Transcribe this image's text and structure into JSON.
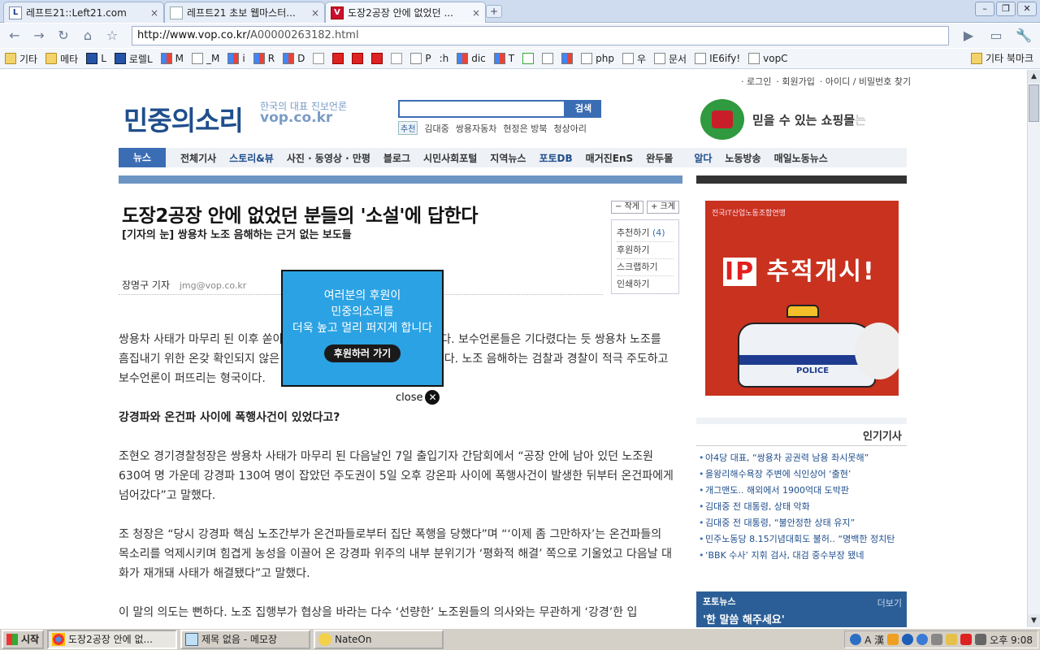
{
  "browser": {
    "tabs": [
      {
        "title": "레프트21::Left21.com",
        "favicon": "left21-icon"
      },
      {
        "title": "레프트21 초보 웹마스터...",
        "favicon": "page-icon"
      },
      {
        "title": "도장2공장 안에 없었던 ...",
        "favicon": "vop-icon",
        "active": true
      }
    ],
    "url_host": "http://www.vop.co.kr/",
    "url_path": "A00000263182.html",
    "bookmarks": [
      "기타",
      "메타",
      "L",
      "로렐L",
      "M",
      "_M",
      "i",
      "R",
      "D",
      "",
      "",
      "",
      "",
      "",
      "P",
      ":h",
      "dic",
      "T",
      "",
      "",
      "",
      "php",
      "우",
      "문서",
      "IE6ify!",
      "vopC"
    ],
    "other_bookmarks": "기타 북마크"
  },
  "site": {
    "util_links": [
      "· 로그인",
      "· 회원가입",
      "· 아이디 / 비밀번호 찾기"
    ],
    "logo": "민중의소리",
    "tagline": "한국의 대표 진보언론",
    "domain": "vop.co.kr",
    "search_button": "검색",
    "hot_tag": "추천",
    "hot_keywords": [
      "김대중",
      "쌍용자동차",
      "현정은 방북",
      "청상아리"
    ],
    "shop_text": "믿을 수 있는 쇼핑몰",
    "shop_fade": "는",
    "nav": {
      "first": "뉴스",
      "items": [
        "전체기사",
        "스토리&뷰",
        "사진 · 동영상 · 만평",
        "블로그",
        "시민사회포털",
        "지역뉴스",
        "포토DB",
        "매거진EnS",
        "완두몰",
        "알다",
        "노동방송",
        "매일노동뉴스"
      ]
    }
  },
  "article": {
    "headline": "도장2공장 안에 없었던 분들의 '소설'에 답한다",
    "subhead": "[기자의 눈] 쌍용차 노조 음해하는 근거 없는 보도들",
    "size_small": "작게",
    "size_large": "크게",
    "actions": [
      "추천하기",
      "(4)",
      "후원하기",
      "스크랩하기",
      "인쇄하기"
    ],
    "reporter": "장명구 기자",
    "email": "jmg@vop.co.kr",
    "paragraphs": [
      "쌍용차 사태가 마무리 된 이후 쏟아지는 보수언론의 기사들은 가관이다. 보수언론들은 기다렸다는 듯 쌍용차 노조를 흠집내기 위한 온갖 확인되지 않은 주장들을 근거로 보도를 일삼고 있다. 노조 음해하는 검찰과 경찰이 적극 주도하고 보수언론이 퍼뜨리는 형국이다.",
      "강경파와 온건파 사이에 폭행사건이 있었다고?",
      "조현오 경기경찰청장은 쌍용차 사태가 마무리 된 다음날인 7일 출입기자 간담회에서 “공장 안에 남아 있던 노조원 630여 명 가운데 강경파 130여 명이 잡았던 주도권이 5일 오후 강온파 사이에 폭행사건이 발생한 뒤부터 온건파에게 넘어갔다”고 말했다.",
      "조 청장은 “당시 강경파 핵심 노조간부가 온건파들로부터 집단 폭행을 당했다”며 “‘이제 좀 그만하자’는 온건파들의 목소리를 억제시키며 힘겹게 농성을 이끌어 온 강경파 위주의 내부 분위기가 ‘평화적 해결’ 쪽으로 기울었고 다음날 대화가 재개돼 사태가 해결됐다”고 말했다.",
      "이 말의 의도는 뻔하다. 노조 집행부가 협상을 바라는 다수 ‘선량한’ 노조원들의 의사와는 무관하게 ‘강경’한 입"
    ]
  },
  "popup": {
    "lines": [
      "여러분의 후원이",
      "민중의소리를",
      "더욱 높고 멀리 퍼지게 합니다"
    ],
    "cta": "후원하러 가기",
    "close": "close"
  },
  "sidebar": {
    "ad_org": "전국IT산업노동조합연맹",
    "ad_text": "추적개시!",
    "ad_ip": "IP",
    "ad_police": "POLICE",
    "popular_title": "인기기사",
    "popular": [
      "야4당 대표, “쌍용차 공권력 남용 좌시못해”",
      "을왕리해수욕장 주변에 식인상어 ‘출현’",
      "개그맨도.. 해외에서 1900억대 도박판",
      "김대중 전 대통령, 상태 악화",
      "김대중 전 대통령, “불안정한 상태 유지”",
      "민주노동당 8.15기념대회도 불허.. “명백한 정치탄",
      "‘BBK 수사’ 지휘 검사, 대검 중수부장 됐네"
    ],
    "photo_label": "포토뉴스",
    "photo_more": "더보기",
    "photo_caption": "'한 말씀 해주세요'"
  },
  "taskbar": {
    "start": "시작",
    "tasks": [
      "도장2공장 안에 없...",
      "제목 없음 - 메모장",
      "NateOn"
    ],
    "clock": "오후 9:08",
    "ime": "A 漢"
  }
}
